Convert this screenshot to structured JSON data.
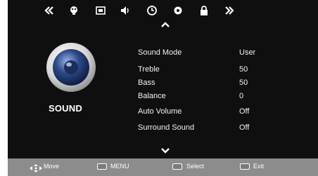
{
  "top_nav": {
    "icons": [
      "chevron-left-icon",
      "picture-icon",
      "screen-icon",
      "speaker-icon",
      "clock-icon",
      "option-icon",
      "lock-icon",
      "chevron-right-icon"
    ],
    "selected": "speaker-icon"
  },
  "sound_panel": {
    "title": "SOUND"
  },
  "menu": {
    "items": [
      {
        "label": "Sound  Mode",
        "value": "User"
      },
      {
        "label": "Treble",
        "value": "50"
      },
      {
        "label": "Bass",
        "value": "50"
      },
      {
        "label": "Balance",
        "value": "0"
      },
      {
        "label": "Auto Volume",
        "value": "Off"
      },
      {
        "label": "Surround Sound",
        "value": "Off"
      }
    ]
  },
  "help_bar": {
    "move": "Move",
    "menu": "MENU",
    "select": "Select",
    "exit": "Exit"
  },
  "colors": {
    "background": "#0f0f0f",
    "help_bar": "#8c8c8c",
    "speaker_cone": "#2d4a8a"
  }
}
